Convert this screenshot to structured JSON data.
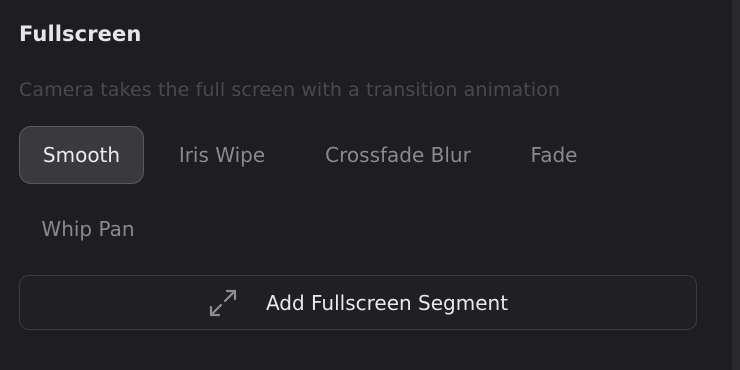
{
  "section": {
    "title": "Fullscreen",
    "description": "Camera takes the full screen with a transition animation"
  },
  "transitions": {
    "selected": "Smooth",
    "options": [
      "Smooth",
      "Iris Wipe",
      "Crossfade Blur",
      "Fade",
      "Whip Pan"
    ]
  },
  "add_button": {
    "label": "Add Fullscreen Segment",
    "icon": "expand-arrows-icon"
  },
  "colors": {
    "background": "#1e1e20",
    "selected_chip": "#3a3a3d",
    "text_primary": "#e9e9eb",
    "text_muted": "#8a8a8e"
  }
}
